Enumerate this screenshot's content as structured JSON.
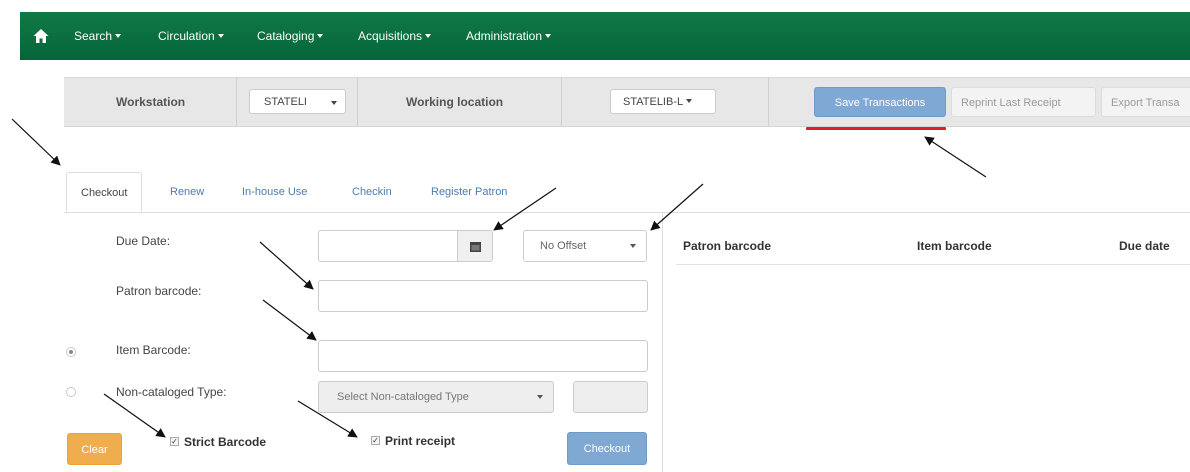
{
  "nav": {
    "menus": [
      "Search",
      "Circulation",
      "Cataloging",
      "Acquisitions",
      "Administration"
    ]
  },
  "workstation_bar": {
    "workstation_label": "Workstation",
    "workstation_value": "STATELI",
    "working_location_label": "Working location",
    "working_location_value": "STATELIB-L",
    "save_transactions": "Save Transactions",
    "reprint_last_receipt": "Reprint Last Receipt",
    "export_transactions": "Export Transa"
  },
  "tabs": [
    "Checkout",
    "Renew",
    "In-house Use",
    "Checkin",
    "Register Patron"
  ],
  "form": {
    "due_date_label": "Due Date:",
    "due_date_value": "",
    "offset_select": "No Offset",
    "patron_barcode_label": "Patron barcode:",
    "patron_barcode_value": "",
    "item_barcode_label": "Item Barcode:",
    "item_barcode_value": "",
    "noncat_label": "Non-cataloged Type:",
    "noncat_select": "Select Non-cataloged Type",
    "noncat_count": "",
    "strict_barcode_label": "Strict Barcode",
    "print_receipt_label": "Print receipt",
    "clear_button": "Clear",
    "checkout_button": "Checkout"
  },
  "table": {
    "columns": [
      "Patron barcode",
      "Item barcode",
      "Due date"
    ]
  },
  "colors": {
    "navbar": "#0a7040",
    "save_button": "#80a8d4",
    "clear_button": "#f0ad4e",
    "checkout_button": "#7fa8d2",
    "underline": "#e02020",
    "annotation_arrow": "#111111"
  },
  "icons": [
    "home-icon",
    "calendar-icon"
  ]
}
